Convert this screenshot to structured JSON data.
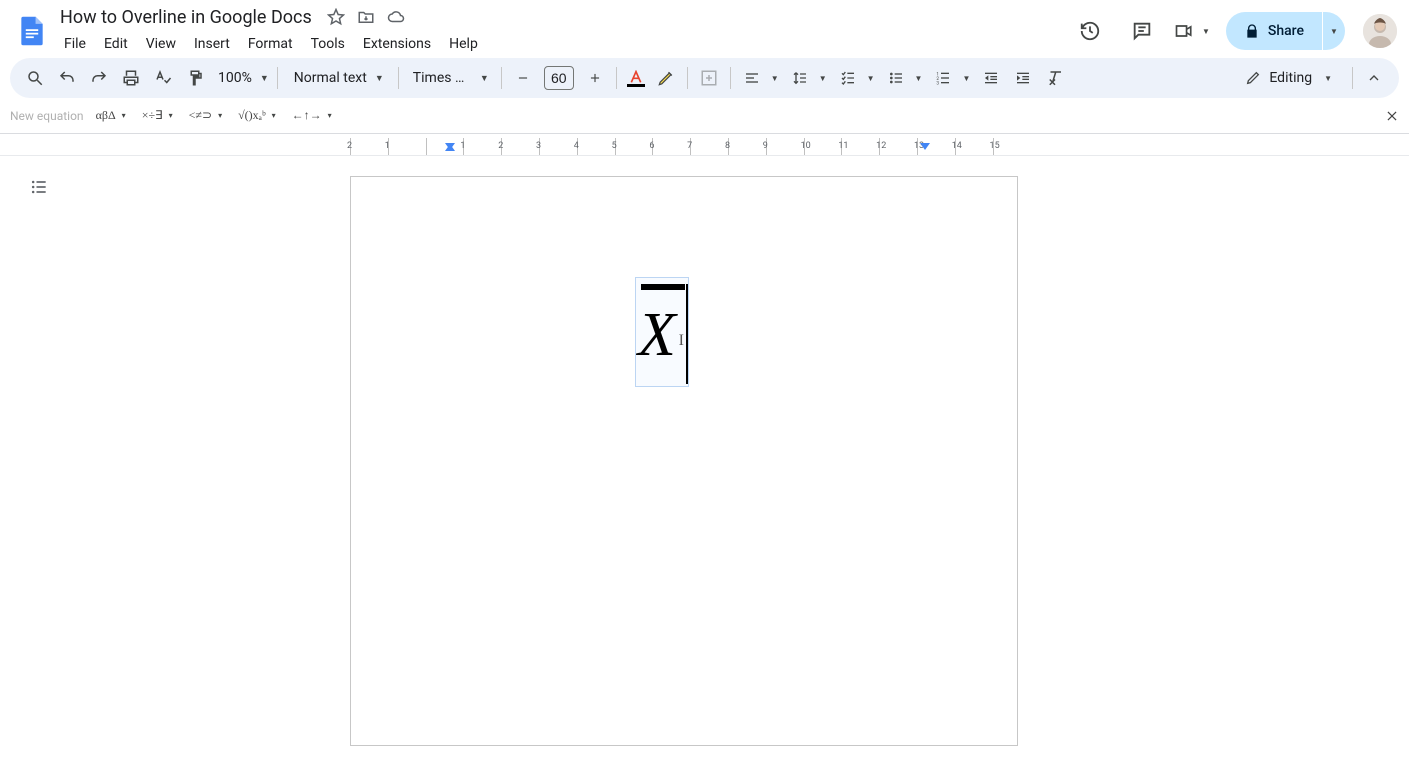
{
  "doc": {
    "title": "How to Overline in Google Docs"
  },
  "menu": {
    "file": "File",
    "edit": "Edit",
    "view": "View",
    "insert": "Insert",
    "format": "Format",
    "tools": "Tools",
    "extensions": "Extensions",
    "help": "Help"
  },
  "toolbar": {
    "zoom": "100%",
    "style": "Normal text",
    "font": "Times …",
    "font_size": "60",
    "mode": "Editing"
  },
  "share": {
    "label": "Share"
  },
  "equation": {
    "label": "New equation",
    "g1": "αβΔ",
    "g2": "×÷∃",
    "g3": "<≠⊃",
    "g4": "√()xₐᵇ",
    "g5": "←↑→",
    "content": "X"
  },
  "ruler": {
    "ticks": [
      "2",
      "1",
      "",
      "1",
      "2",
      "3",
      "4",
      "5",
      "6",
      "7",
      "8",
      "9",
      "10",
      "11",
      "12",
      "13",
      "14",
      "15"
    ]
  }
}
